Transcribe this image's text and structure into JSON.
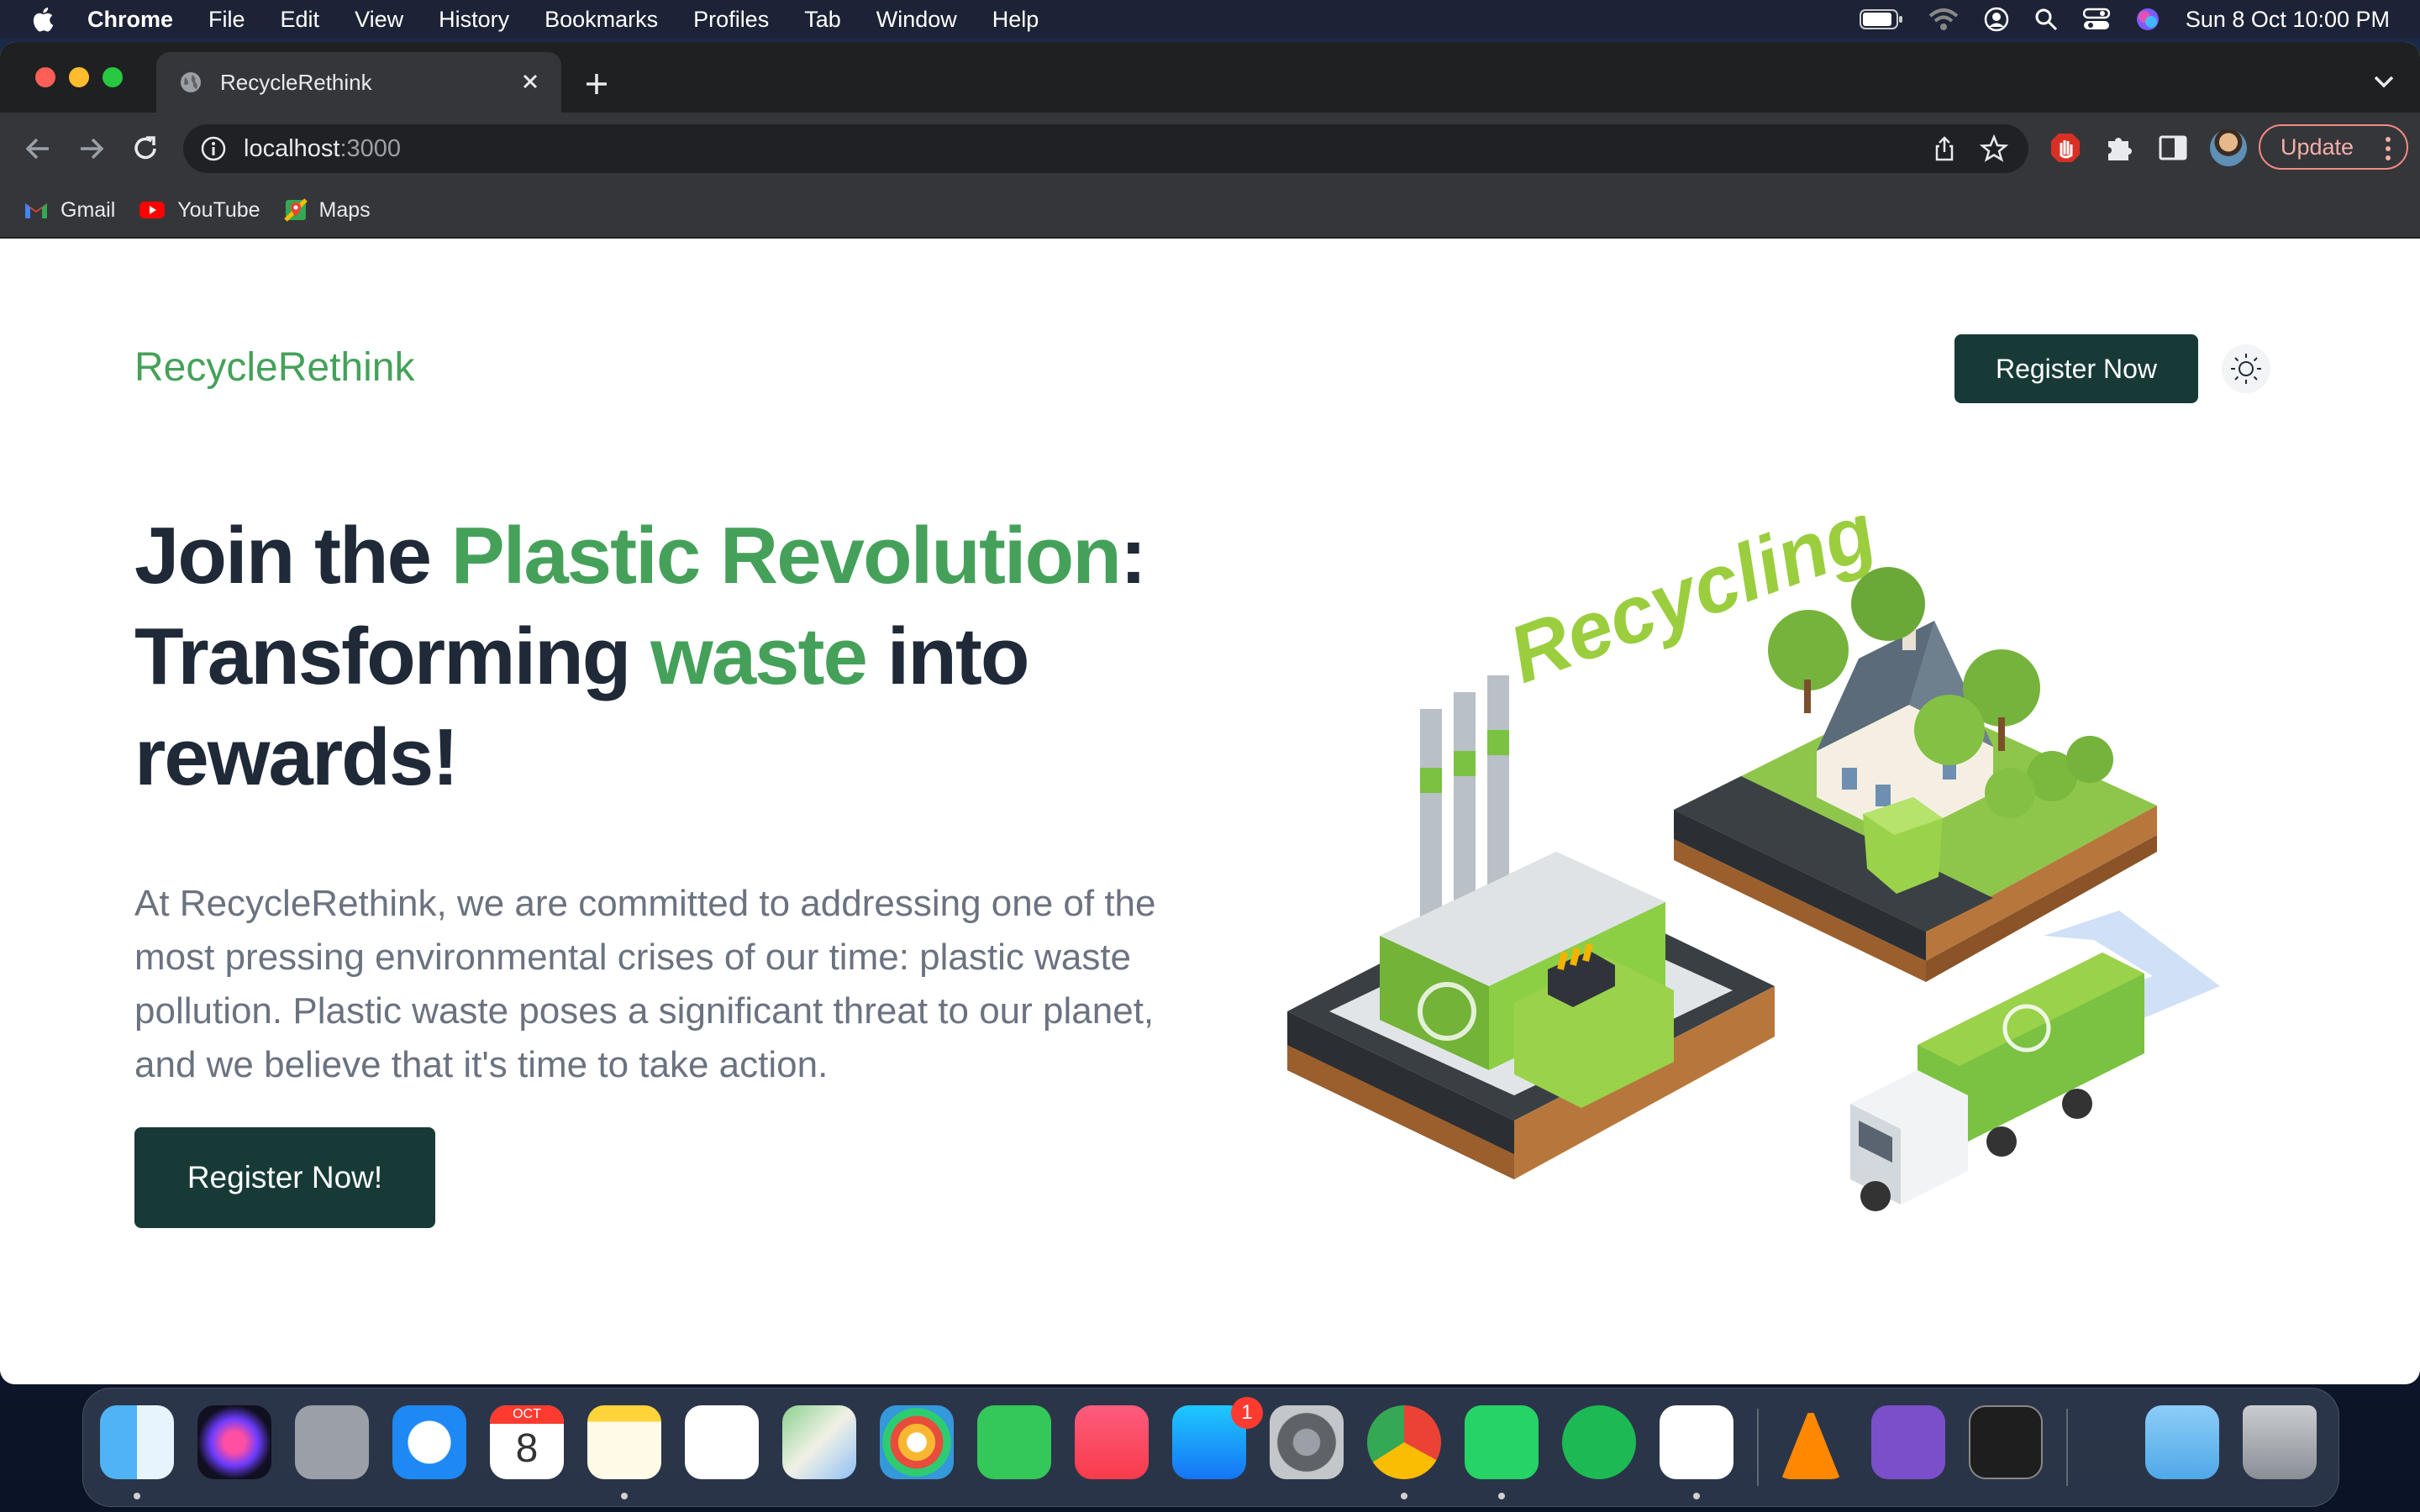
{
  "menubar": {
    "app_name": "Chrome",
    "items": [
      "File",
      "Edit",
      "View",
      "History",
      "Bookmarks",
      "Profiles",
      "Tab",
      "Window",
      "Help"
    ],
    "clock": "Sun 8 Oct  10:00 PM"
  },
  "browser": {
    "tab_title": "RecycleRethink",
    "url_host": "localhost",
    "url_port": ":3000",
    "update_label": "Update",
    "bookmarks": [
      "Gmail",
      "YouTube",
      "Maps"
    ]
  },
  "page": {
    "brand": "RecycleRethink",
    "nav_register": "Register Now",
    "hero": {
      "title_part1": "Join the ",
      "title_highlight1": "Plastic Revolution",
      "title_part2": ": Transforming ",
      "title_highlight2": "waste",
      "title_part3": " into rewards!",
      "description": "At RecycleRethink, we are committed to addressing one of the most pressing environmental crises of our time: plastic waste pollution. Plastic waste poses a significant threat to our planet, and we believe that it's time to take action.",
      "cta": "Register Now!"
    },
    "illustration": {
      "label": "Recycling"
    }
  },
  "dock": {
    "calendar_month": "OCT",
    "calendar_day": "8",
    "appstore_badge": "1"
  },
  "colors": {
    "brand_green": "#45a15a",
    "button_dark": "#173a37",
    "heading": "#1f2937",
    "body_text": "#6b7280"
  }
}
